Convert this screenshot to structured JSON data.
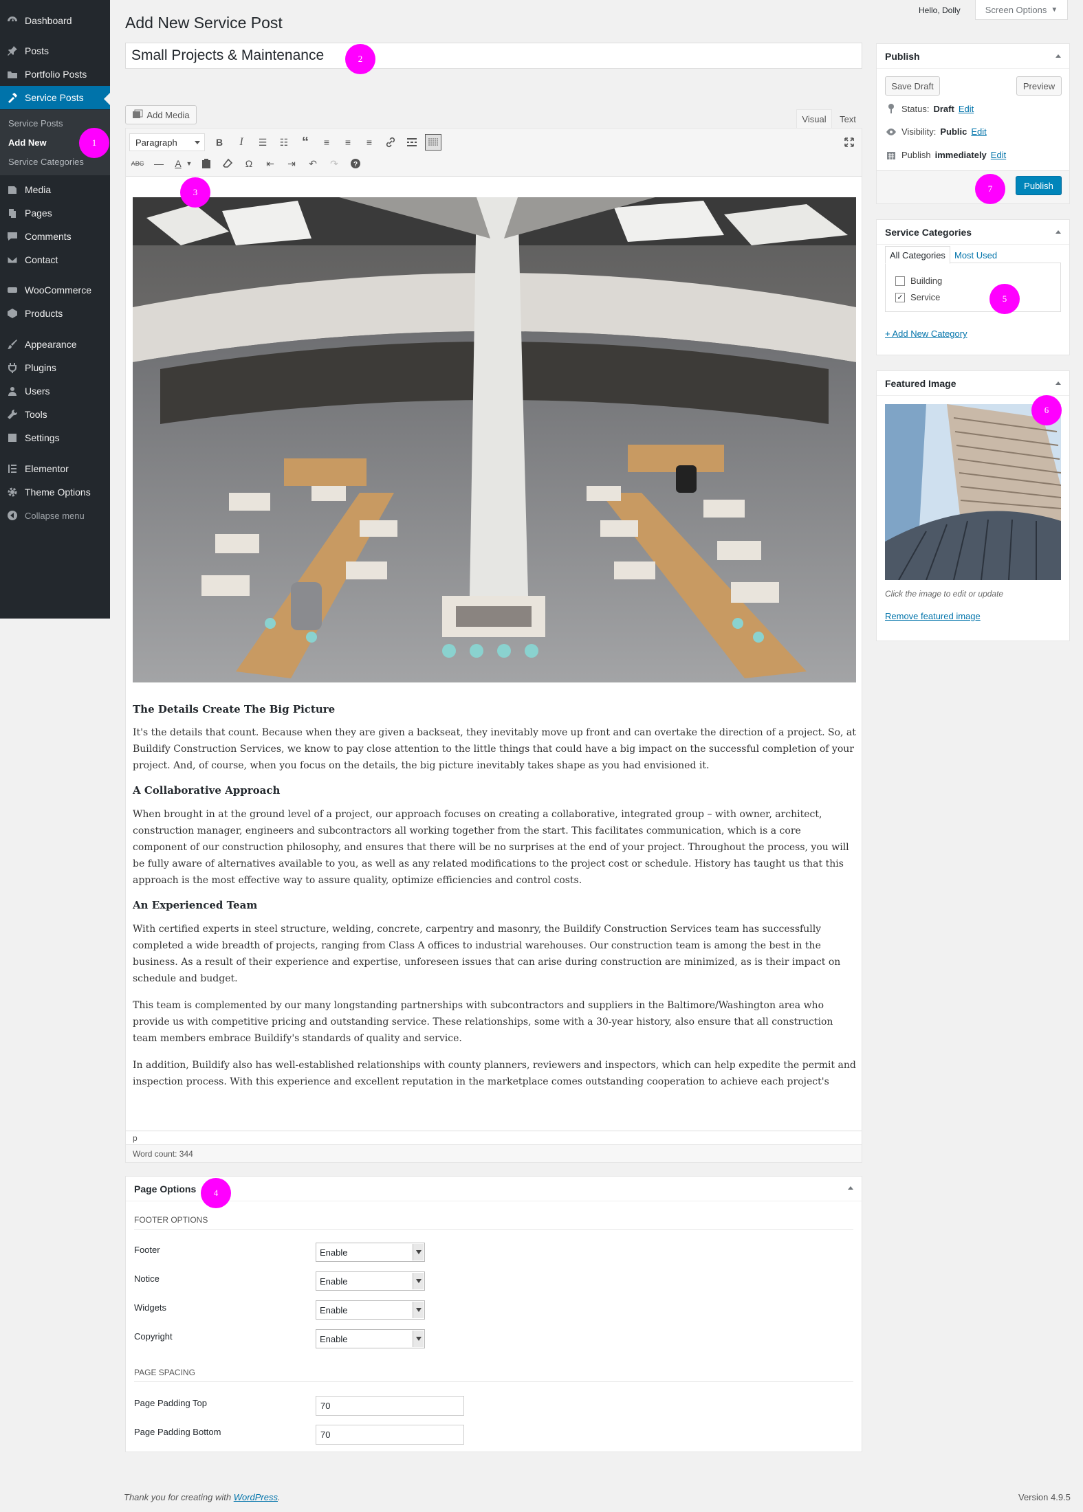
{
  "sidebar": {
    "items": [
      {
        "label": "Dashboard",
        "icon": "dashboard-icon"
      },
      {
        "label": "Posts",
        "icon": "pin-icon"
      },
      {
        "label": "Portfolio Posts",
        "icon": "folder-icon"
      },
      {
        "label": "Service Posts",
        "icon": "hammer-icon"
      },
      {
        "label": "Media",
        "icon": "media-icon"
      },
      {
        "label": "Pages",
        "icon": "pages-icon"
      },
      {
        "label": "Comments",
        "icon": "comment-icon"
      },
      {
        "label": "Contact",
        "icon": "envelope-icon"
      },
      {
        "label": "WooCommerce",
        "icon": "woo-icon"
      },
      {
        "label": "Products",
        "icon": "products-icon"
      },
      {
        "label": "Appearance",
        "icon": "brush-icon"
      },
      {
        "label": "Plugins",
        "icon": "plugin-icon"
      },
      {
        "label": "Users",
        "icon": "user-icon"
      },
      {
        "label": "Tools",
        "icon": "wrench-icon"
      },
      {
        "label": "Settings",
        "icon": "settings-icon"
      },
      {
        "label": "Elementor",
        "icon": "elementor-icon"
      },
      {
        "label": "Theme Options",
        "icon": "gear-icon"
      },
      {
        "label": "Collapse menu",
        "icon": "collapse-icon"
      }
    ],
    "submenu": [
      "Service Posts",
      "Add New",
      "Service Categories"
    ]
  },
  "markers": [
    "1",
    "2",
    "3",
    "4",
    "5",
    "6",
    "7"
  ],
  "topbar": {
    "greeting": "Hello, Dolly",
    "screen_options": "Screen Options"
  },
  "page_title": "Add New Service Post",
  "post_title": "Small Projects & Maintenance",
  "editor": {
    "add_media": "Add Media",
    "tab_visual": "Visual",
    "tab_text": "Text",
    "format_select": "Paragraph",
    "path": "p",
    "word_count": "Word count: 344"
  },
  "content": {
    "h1": "The Details Create The Big Picture",
    "p1": "It's the details that count. Because when they are given a backseat, they inevitably move up front and can overtake the direction of a project. So, at Buildify Construction Services, we know to pay close attention to the little things that could have a big impact on the successful completion of your project. And, of course, when you focus on the details, the big picture inevitably takes shape as you had envisioned it.",
    "h2": "A Collaborative Approach",
    "p2": "When brought in at the ground level of a project, our approach focuses on creating a collaborative, integrated group – with owner, architect, construction manager, engineers and subcontractors all working together from the start. This facilitates communication, which is a core component of our construction philosophy, and ensures that there will be no surprises at the end of your project. Throughout the process, you will be fully aware of alternatives available to you, as well as any related modifications to the project cost or schedule. History has taught us that this approach is the most effective way to assure quality, optimize efficiencies and control costs.",
    "h3": "An Experienced Team",
    "p3": "With certified experts in steel structure, welding, concrete, carpentry and masonry, the Buildify Construction Services team has successfully completed a wide breadth of projects, ranging from Class A offices to industrial warehouses. Our construction team is among the best in the business. As a result of their experience and expertise, unforeseen issues that can arise during construction are minimized, as is their impact on schedule and budget.",
    "p4": "This team is complemented by our many longstanding partnerships with subcontractors and suppliers in the Baltimore/Washington area who provide us with competitive pricing and outstanding service. These relationships, some with a 30-year history, also ensure that all construction team members embrace Buildify's standards of quality and service.",
    "p5": "In addition, Buildify also has well-established relationships with county planners, reviewers and inspectors, which can help expedite the permit and inspection process. With this experience and excellent reputation in the marketplace comes outstanding cooperation to achieve each project's schedule and budget."
  },
  "page_options": {
    "title": "Page Options",
    "footer_section": "FOOTER OPTIONS",
    "rows": [
      {
        "label": "Footer",
        "value": "Enable"
      },
      {
        "label": "Notice",
        "value": "Enable"
      },
      {
        "label": "Widgets",
        "value": "Enable"
      },
      {
        "label": "Copyright",
        "value": "Enable"
      }
    ],
    "spacing_section": "PAGE SPACING",
    "padding_top_label": "Page Padding Top",
    "padding_top_value": "70",
    "padding_bottom_label": "Page Padding Bottom",
    "padding_bottom_value": "70"
  },
  "publish": {
    "title": "Publish",
    "save_draft": "Save Draft",
    "preview": "Preview",
    "status_label": "Status:",
    "status_value": "Draft",
    "visibility_label": "Visibility:",
    "visibility_value": "Public",
    "publish_label": "Publish",
    "publish_value": "immediately",
    "edit": "Edit",
    "publish_button": "Publish"
  },
  "categories": {
    "title": "Service Categories",
    "tab_all": "All Categories",
    "tab_most_used": "Most Used",
    "items": [
      {
        "label": "Building",
        "checked": false
      },
      {
        "label": "Service",
        "checked": true
      }
    ],
    "add_new": "+ Add New Category"
  },
  "featured": {
    "title": "Featured Image",
    "hint": "Click the image to edit or update",
    "remove": "Remove featured image"
  },
  "footer": {
    "thanks": "Thank you for creating with ",
    "wp_link": "WordPress",
    "period": ".",
    "version": "Version 4.9.5"
  },
  "colors": {
    "accent": "#0073aa",
    "primary_button": "#0085ba",
    "sidebar": "#23282d",
    "marker": "#ff00ff"
  }
}
